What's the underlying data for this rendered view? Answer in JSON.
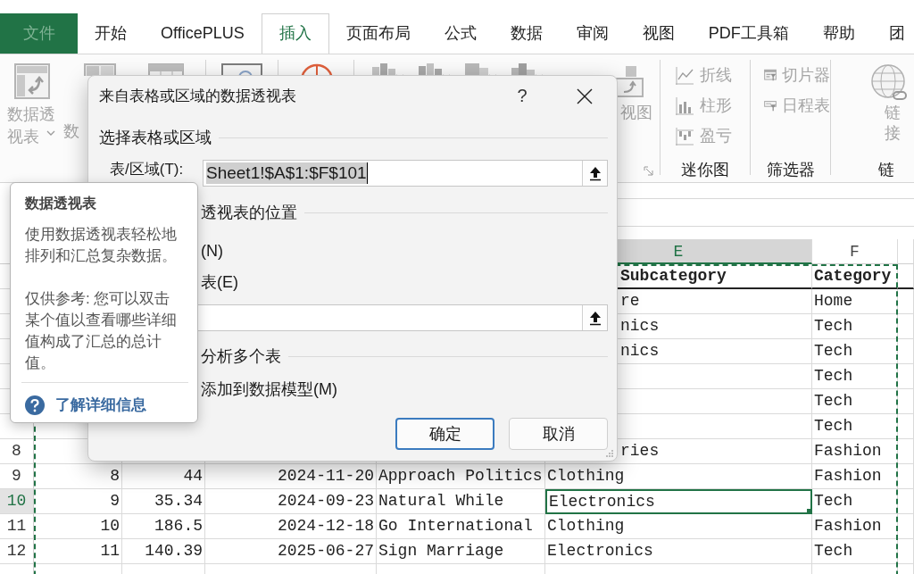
{
  "tabs": [
    {
      "label": "文件",
      "kind": "file",
      "selected": false
    },
    {
      "label": "开始",
      "kind": "tab",
      "selected": false
    },
    {
      "label": "OfficePLUS",
      "kind": "tab",
      "selected": false
    },
    {
      "label": "插入",
      "kind": "tab",
      "selected": true
    },
    {
      "label": "页面布局",
      "kind": "tab",
      "selected": false
    },
    {
      "label": "公式",
      "kind": "tab",
      "selected": false
    },
    {
      "label": "数据",
      "kind": "tab",
      "selected": false
    },
    {
      "label": "审阅",
      "kind": "tab",
      "selected": false
    },
    {
      "label": "视图",
      "kind": "tab",
      "selected": false
    },
    {
      "label": "PDF工具箱",
      "kind": "tab",
      "selected": false
    },
    {
      "label": "帮助",
      "kind": "tab",
      "selected": false
    },
    {
      "label": "团",
      "kind": "tab",
      "selected": false
    }
  ],
  "ribbon": {
    "pivot_table": {
      "lines": [
        "数据透",
        "视表"
      ],
      "disabled": true
    },
    "recommended": {
      "label": "数",
      "disabled": true
    },
    "pivot_chart": {
      "label": "视图",
      "disabled": true
    },
    "sparklines": {
      "title": "迷你图",
      "items": [
        {
          "label": "折线",
          "kind": "line",
          "disabled": true
        },
        {
          "label": "柱形",
          "kind": "column",
          "disabled": true
        },
        {
          "label": "盈亏",
          "kind": "winloss",
          "disabled": true
        }
      ]
    },
    "filters": {
      "title": "筛选器",
      "items": [
        {
          "label": "切片器",
          "kind": "slicer",
          "disabled": true
        },
        {
          "label": "日程表",
          "kind": "timeline",
          "disabled": true
        }
      ]
    },
    "links": {
      "title": "链",
      "lines": [
        "链",
        "接"
      ],
      "disabled": true
    }
  },
  "columns": {
    "E": {
      "letter": "E",
      "selected": true
    },
    "F": {
      "letter": "F",
      "selected": false
    }
  },
  "rows": [
    {
      "kind": "header",
      "cells": {
        "E": {
          "text": "Subcategory",
          "clipped": true
        },
        "F": {
          "text": "Category"
        }
      }
    },
    {
      "kind": "data",
      "cells": {
        "E": {
          "text": "re",
          "clipped": true
        },
        "F": {
          "text": "Home"
        }
      }
    },
    {
      "kind": "data",
      "cells": {
        "E": {
          "text": "nics",
          "clipped": true
        },
        "F": {
          "text": "Tech"
        }
      }
    },
    {
      "kind": "data",
      "cells": {
        "E": {
          "text": "nics",
          "clipped": true
        },
        "F": {
          "text": "Tech"
        }
      }
    },
    {
      "kind": "data",
      "cells": {
        "F": {
          "text": "Tech"
        }
      }
    },
    {
      "kind": "data",
      "cells": {
        "F": {
          "text": "Tech"
        }
      }
    },
    {
      "kind": "data",
      "cells": {
        "F": {
          "text": "Tech"
        }
      }
    },
    {
      "kind": "data",
      "number": "8",
      "selected": false,
      "cells": {
        "E": {
          "text": "ries",
          "clipped": true
        },
        "F": {
          "text": "Fashion"
        }
      }
    },
    {
      "kind": "data",
      "number": "9",
      "selected": false,
      "cells": {
        "A": {
          "text": "8"
        },
        "B": {
          "text": "44"
        },
        "C": {
          "text": "2024-11-20"
        },
        "D": {
          "text": "Approach Politics"
        },
        "E": {
          "text": "Clothing"
        },
        "F": {
          "text": "Fashion"
        }
      }
    },
    {
      "kind": "data",
      "number": "10",
      "selected": true,
      "cells": {
        "A": {
          "text": "9"
        },
        "B": {
          "text": "35.34"
        },
        "C": {
          "text": "2024-09-23"
        },
        "D": {
          "text": "Natural While"
        },
        "E": {
          "text": "Electronics",
          "active": true
        },
        "F": {
          "text": "Tech"
        }
      }
    },
    {
      "kind": "data",
      "number": "11",
      "selected": false,
      "cells": {
        "A": {
          "text": "10"
        },
        "B": {
          "text": "186.5"
        },
        "C": {
          "text": "2024-12-18"
        },
        "D": {
          "text": "Go International"
        },
        "E": {
          "text": "Clothing"
        },
        "F": {
          "text": "Fashion"
        }
      }
    },
    {
      "kind": "data",
      "number": "12",
      "selected": false,
      "cells": {
        "A": {
          "text": "11"
        },
        "B": {
          "text": "140.39"
        },
        "C": {
          "text": "2025-06-27"
        },
        "D": {
          "text": "Sign Marriage"
        },
        "E": {
          "text": "Electronics"
        },
        "F": {
          "text": "Tech"
        }
      }
    }
  ],
  "dialog": {
    "title": "来自表格或区域的数据透视表",
    "help_label": "?",
    "source_heading": "选择表格或区域",
    "range_label": "表/区域(T):",
    "range_value": "Sheet1!$A$1:$F$101",
    "range_value_selected": true,
    "placement_heading": "透视表的位置",
    "placement_options": [
      {
        "label": "(N)"
      },
      {
        "label": "表(E)"
      }
    ],
    "multi_heading": "分析多个表",
    "data_model": {
      "label": "添加到数据模型(M)"
    },
    "buttons": [
      {
        "label": "确定",
        "default": true
      },
      {
        "label": "取消",
        "default": false
      }
    ]
  },
  "tooltip": {
    "title": "数据透视表",
    "paragraphs": [
      "使用数据透视表轻松地排列和汇总复杂数据。",
      "仅供参考: 您可以双击某个值以查看哪些详细值构成了汇总的总计值。"
    ],
    "link": "了解详细信息"
  }
}
